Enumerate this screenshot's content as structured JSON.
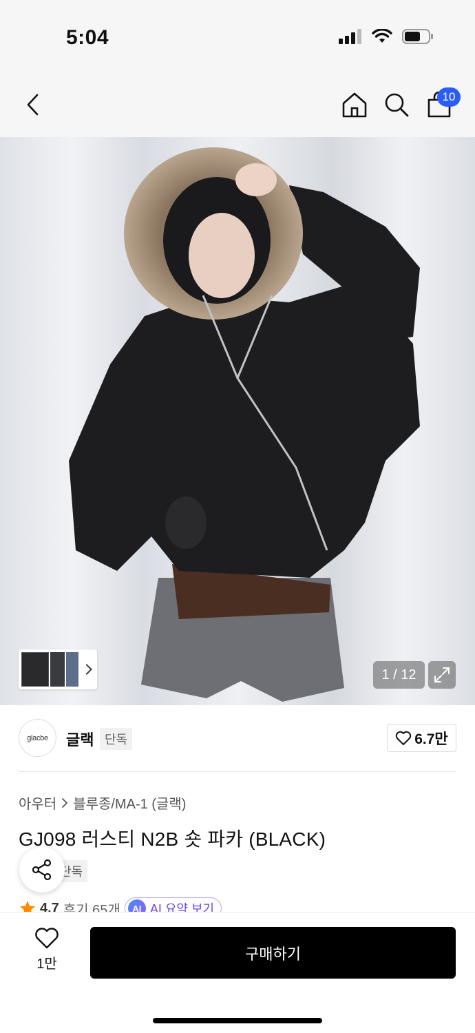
{
  "status_bar": {
    "time": "5:04"
  },
  "nav": {
    "back_icon": "chevron-left-icon",
    "home_icon": "home-icon",
    "search_icon": "search-icon",
    "cart_icon": "shopping-bag-icon",
    "cart_count": "10"
  },
  "gallery": {
    "counter": "1 / 12",
    "expand_icon": "expand-icon"
  },
  "brand": {
    "logo_text": "glacbe",
    "name": "글랙",
    "tag": "단독",
    "likes": "6.7만"
  },
  "breadcrumb": {
    "category": "아우터",
    "subcategory": "블루종/MA-1 (글랙)"
  },
  "product": {
    "title": "GJ098 러스티 N2B 숏 파카 (BLACK)",
    "exclusive_tag": "단독"
  },
  "rating": {
    "score": "4.7",
    "reviews": "후기 65개",
    "ai_label": "AI 요약 보기",
    "ai_badge": "AI"
  },
  "bottom": {
    "wish_count": "1만",
    "buy_label": "구매하기"
  },
  "colors": {
    "accent_blue": "#2b5cf6",
    "ai_purple": "#6b46e5",
    "star": "#ff8a00"
  }
}
